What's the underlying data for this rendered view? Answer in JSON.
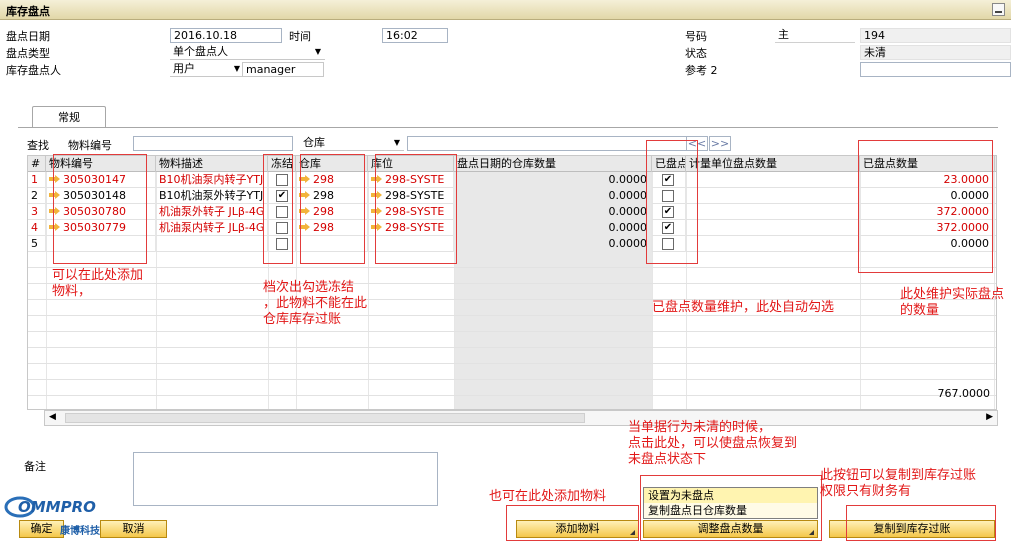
{
  "window": {
    "title": "库存盘点"
  },
  "header": {
    "count_date_label": "盘点日期",
    "count_date": "2016.10.18",
    "time_label": "时间",
    "time": "16:02",
    "count_type_label": "盘点类型",
    "count_type": "单个盘点人",
    "counter_label": "库存盘点人",
    "counter_type": "用户",
    "counter_name": "manager",
    "number_label": "号码",
    "series": "主",
    "number": "194",
    "status_label": "状态",
    "status": "未清",
    "ref2_label": "参考 2",
    "ref2": ""
  },
  "tabs": [
    {
      "label": "常规"
    }
  ],
  "find": {
    "label": "查找",
    "item_no_label": "物料编号",
    "item_no_value": "",
    "warehouse_select": "仓库",
    "warehouse_value": "",
    "nav_prev": "<<",
    "nav_next": ">>"
  },
  "table": {
    "headers": [
      "#",
      "物料编号",
      "物料描述",
      "冻结",
      "仓库",
      "库位",
      "盘点日期的仓库数量",
      "已盘点",
      "计量单位盘点数量",
      "已盘点数量"
    ],
    "rows": [
      {
        "n": "1",
        "item": "305030147",
        "desc": "B10机油泵内转子YTJ",
        "frozen": false,
        "wh": "298",
        "bin": "298-SYSTE",
        "whqty": "0.0000",
        "counted": true,
        "qty": "23.0000",
        "red": true
      },
      {
        "n": "2",
        "item": "305030148",
        "desc": "B10机油泵外转子YTJ",
        "frozen": true,
        "wh": "298",
        "bin": "298-SYSTE",
        "whqty": "0.0000",
        "counted": false,
        "qty": "0.0000",
        "red": false
      },
      {
        "n": "3",
        "item": "305030780",
        "desc": "机油泵外转子 JLβ-4G",
        "frozen": false,
        "wh": "298",
        "bin": "298-SYSTE",
        "whqty": "0.0000",
        "counted": true,
        "qty": "372.0000",
        "red": true
      },
      {
        "n": "4",
        "item": "305030779",
        "desc": "机油泵内转子 JLβ-4G",
        "frozen": false,
        "wh": "298",
        "bin": "298-SYSTE",
        "whqty": "0.0000",
        "counted": true,
        "qty": "372.0000",
        "red": true
      },
      {
        "n": "5",
        "item": "",
        "desc": "",
        "frozen": false,
        "wh": "",
        "bin": "",
        "whqty": "0.0000",
        "counted": false,
        "qty": "0.0000",
        "red": false
      }
    ],
    "total": "767.0000"
  },
  "remarks_label": "备注",
  "remarks": "",
  "buttons": {
    "ok": "确定",
    "cancel": "取消",
    "add_item": "添加物料",
    "adjust_count": "调整盘点数量",
    "copy_posting": "复制到库存过账"
  },
  "dropdown_menu": [
    "设置为未盘点",
    "复制盘点日仓库数量"
  ],
  "logo_text": "COMMPRO",
  "logo_sub": "康博科技",
  "annotations": {
    "a1": "可以在此处添加\n物料，",
    "a2": "档次出勾选冻结\n，此物料不能在此\n仓库库存过账",
    "a3": "已盘点数量维护，此处自动勾选",
    "a4": "此处维护实际盘点\n的数量",
    "a5": "当单据行为未清的时候，\n点击此处，可以使盘点恢复到\n未盘点状态下",
    "a6": "也可在此处添加物料",
    "a7": "此按钮可以复制到库存过账\n权限只有财务有"
  }
}
